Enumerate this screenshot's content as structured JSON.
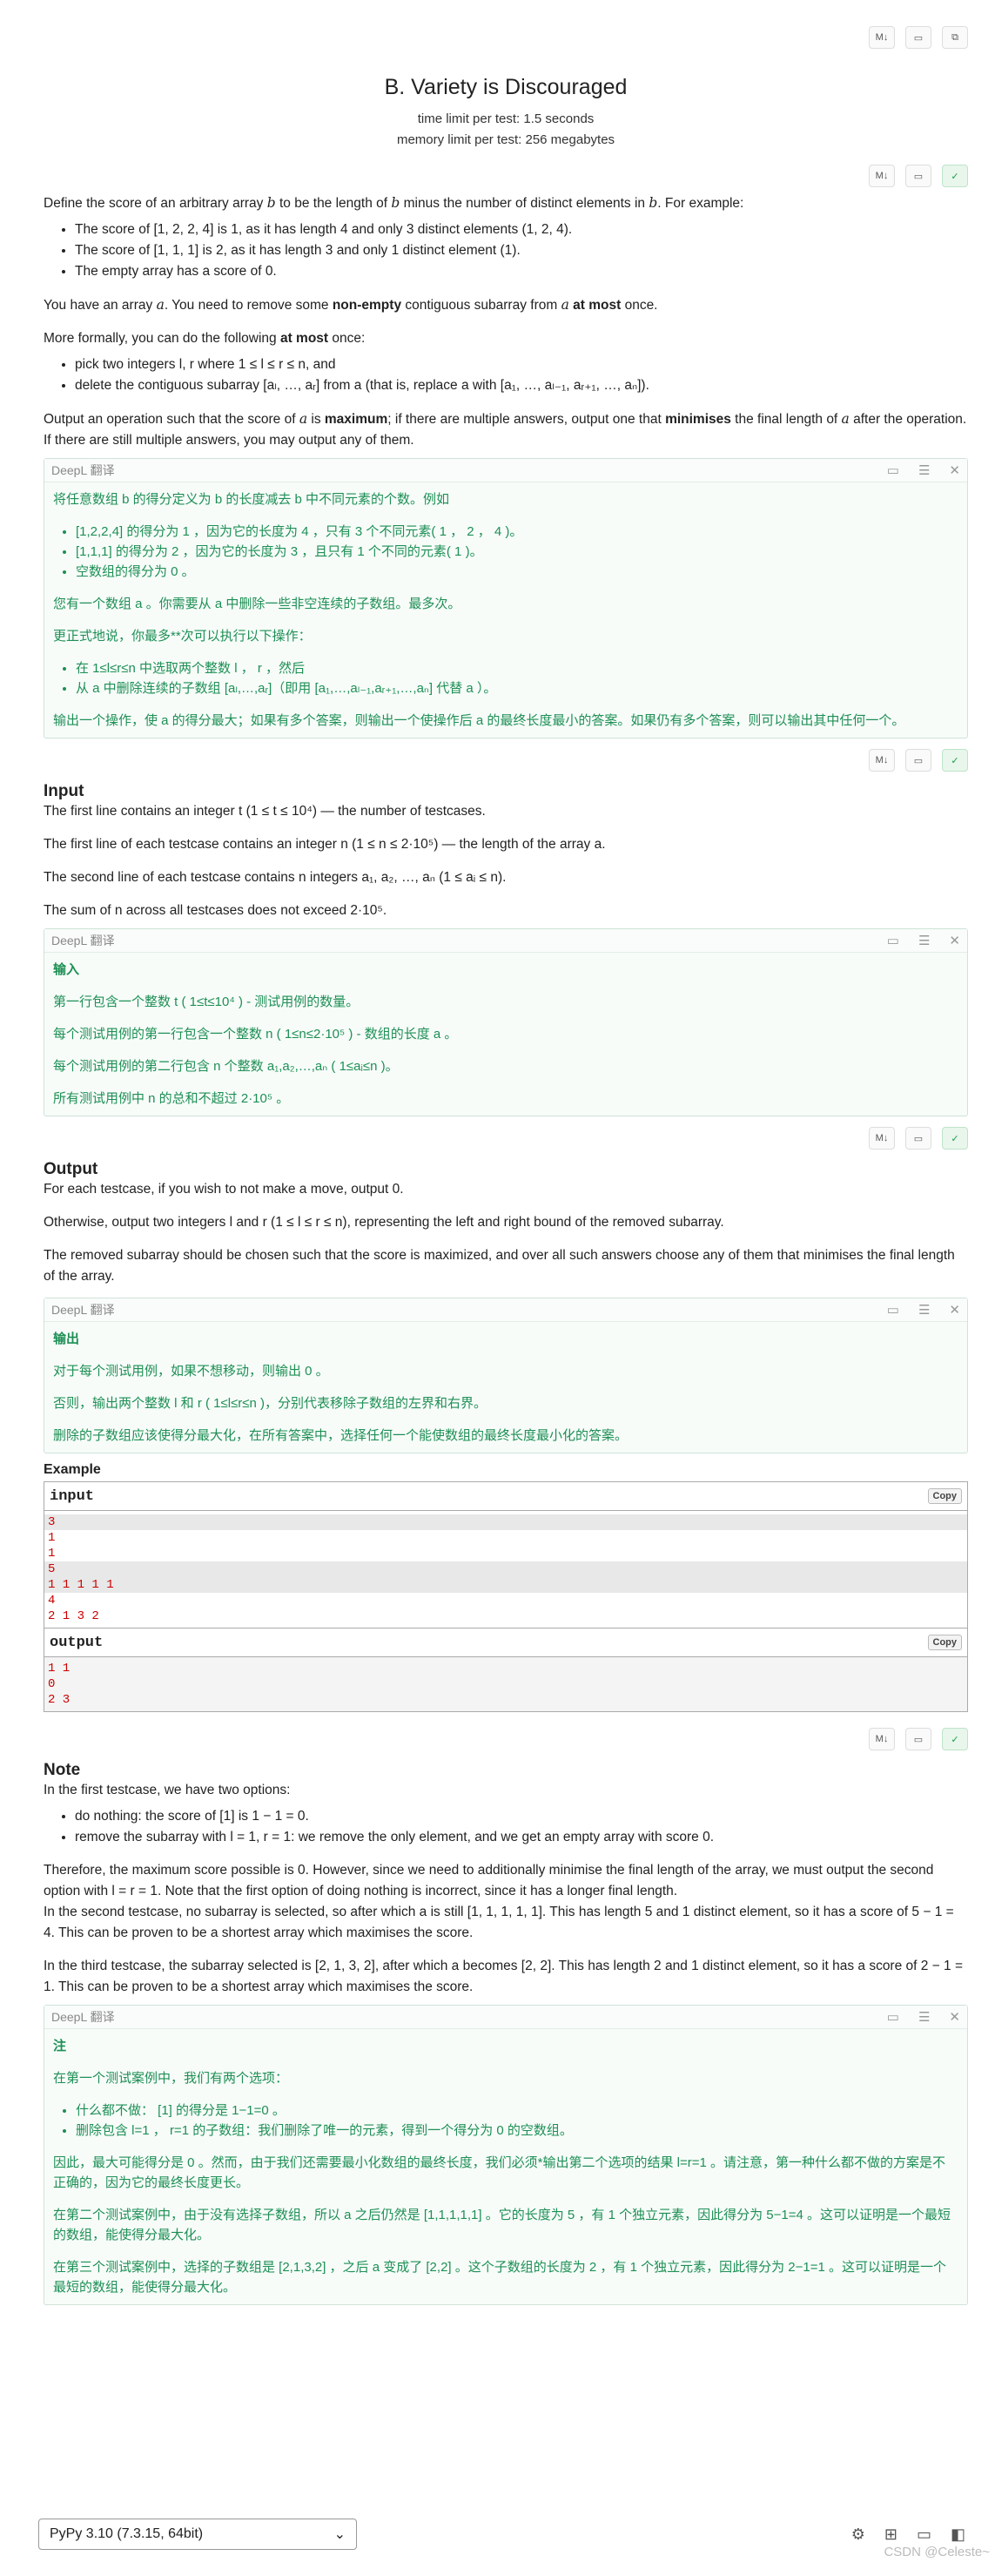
{
  "toolbar": {
    "md_label": "M↓",
    "copy_icon": "clipboard-icon",
    "done_icon": "check-icon"
  },
  "problem": {
    "title": "B. Variety is Discouraged",
    "time_limit": "time limit per test: 1.5 seconds",
    "memory_limit": "memory limit per test: 256 megabytes"
  },
  "statement": {
    "p1a": "Define the score of an arbitrary array ",
    "p1b": " to be the length of ",
    "p1c": " minus the number of distinct elements in ",
    "p1d": ". For example:",
    "li1": "The score of [1, 2, 2, 4] is 1, as it has length 4 and only 3 distinct elements (1, 2, 4).",
    "li2": "The score of [1, 1, 1] is 2, as it has length 3 and only 1 distinct element (1).",
    "li3": "The empty array has a score of 0.",
    "p2a": "You have an array ",
    "p2b": ". You need to remove some ",
    "p2c": "non-empty",
    "p2d": " contiguous subarray from ",
    "p2e": " at most",
    "p2f": " once.",
    "p3a": "More formally, you can do the following ",
    "p3b": "at most",
    "p3c": " once:",
    "li4": "pick two integers l, r where 1 ≤ l ≤ r ≤ n, and",
    "li5": "delete the contiguous subarray [aₗ, …, aᵣ] from a (that is, replace a with [a₁, …, aₗ₋₁, aᵣ₊₁, …, aₙ]).",
    "p4a": "Output an operation such that the score of ",
    "p4b": " is ",
    "p4c": "maximum",
    "p4d": "; if there are multiple answers, output one that ",
    "p4e": "minimises",
    "p4f": " the final length of ",
    "p4g": " after the operation. If there are still multiple answers, you may output any of them."
  },
  "deepl": {
    "label": "DeepL 翻译",
    "s1_p1": "将任意数组 b 的得分定义为 b 的长度减去 b 中不同元素的个数。例如",
    "s1_li1": "[1,2,2,4] 的得分为 1 ，因为它的长度为 4 ，只有 3 个不同元素( 1 ， 2 ， 4 )。",
    "s1_li2": "[1,1,1] 的得分为 2 ，因为它的长度为 3 ，且只有 1 个不同的元素( 1 )。",
    "s1_li3": "空数组的得分为 0 。",
    "s1_p2": "您有一个数组 a 。你需要从 a 中删除一些非空连续的子数组。最多次。",
    "s1_p3": "更正式地说，你最多**次可以执行以下操作：",
    "s1_li4": "在 1≤l≤r≤n 中选取两个整数 l ， r ，然后",
    "s1_li5": "从 a 中删除连续的子数组 [aₗ,…,aᵣ]（即用 [a₁,…,aₗ₋₁,aᵣ₊₁,…,aₙ] 代替 a ）。",
    "s1_p4": "输出一个操作，使 a 的得分最大；如果有多个答案，则输出一个使操作后 a 的最终长度最小的答案。如果仍有多个答案，则可以输出其中任何一个。",
    "s2_title": "输入",
    "s2_p1": "第一行包含一个整数 t ( 1≤t≤10⁴ ) - 测试用例的数量。",
    "s2_p2": "每个测试用例的第一行包含一个整数 n ( 1≤n≤2·10⁵ ) - 数组的长度 a 。",
    "s2_p3": "每个测试用例的第二行包含 n 个整数 a₁,a₂,…,aₙ ( 1≤aᵢ≤n )。",
    "s2_p4": "所有测试用例中 n 的总和不超过 2·10⁵ 。",
    "s3_title": "输出",
    "s3_p1": "对于每个测试用例，如果不想移动，则输出 0 。",
    "s3_p2": "否则，输出两个整数 l 和 r ( 1≤l≤r≤n )，分别代表移除子数组的左界和右界。",
    "s3_p3": "删除的子数组应该使得分最大化，在所有答案中，选择任何一个能使数组的最终长度最小化的答案。",
    "s4_title": "注",
    "s4_p1": "在第一个测试案例中，我们有两个选项：",
    "s4_li1": "什么都不做： [1] 的得分是 1−1=0 。",
    "s4_li2": "删除包含 l=1 ， r=1 的子数组：我们删除了唯一的元素，得到一个得分为 0 的空数组。",
    "s4_p2": "因此，最大可能得分是 0 。然而，由于我们还需要最小化数组的最终长度，我们必须*输出第二个选项的结果 l=r=1 。请注意，第一种什么都不做的方案是不正确的，因为它的最终长度更长。",
    "s4_p3": "在第二个测试案例中，由于没有选择子数组，所以 a 之后仍然是 [1,1,1,1,1] 。它的长度为 5 ，有 1 个独立元素，因此得分为 5−1=4 。这可以证明是一个最短的数组，能使得分最大化。",
    "s4_p4": "在第三个测试案例中，选择的子数组是 [2,1,3,2] ，之后 a 变成了 [2,2] 。这个子数组的长度为 2 ，有 1 个独立元素，因此得分为 2−1=1 。这可以证明是一个最短的数组，能使得分最大化。"
  },
  "input_section": {
    "title": "Input",
    "p1": "The first line contains an integer t (1 ≤ t ≤ 10⁴) — the number of testcases.",
    "p2": "The first line of each testcase contains an integer n (1 ≤ n ≤ 2·10⁵) — the length of the array a.",
    "p3": "The second line of each testcase contains n integers a₁, a₂, …, aₙ (1 ≤ aᵢ ≤ n).",
    "p4": "The sum of n across all testcases does not exceed 2·10⁵."
  },
  "output_section": {
    "title": "Output",
    "p1": "For each testcase, if you wish to not make a move, output 0.",
    "p2": "Otherwise, output two integers l and r (1 ≤ l ≤ r ≤ n), representing the left and right bound of the removed subarray.",
    "p3": "The removed subarray should be chosen such that the score is maximized, and over all such answers choose any of them that minimises the final length of the array."
  },
  "example": {
    "title": "Example",
    "input_label": "input",
    "output_label": "output",
    "copy": "Copy",
    "input_lines": [
      "3",
      "1",
      "1",
      "5",
      "1 1 1 1 1",
      "4",
      "2 1 3 2"
    ],
    "output_lines": [
      "1 1",
      "0",
      "2 3"
    ]
  },
  "note": {
    "title": "Note",
    "p1": "In the first testcase, we have two options:",
    "li1": "do nothing: the score of [1] is 1 − 1 = 0.",
    "li2": "remove the subarray with l = 1, r = 1: we remove the only element, and we get an empty array with score 0.",
    "p2": "Therefore, the maximum score possible is 0. However, since we need to additionally minimise the final length of the array, we must output the second option with l = r = 1. Note that the first option of doing nothing is incorrect, since it has a longer final length.",
    "p3": "In the second testcase, no subarray is selected, so after which a is still [1, 1, 1, 1, 1]. This has length 5 and 1 distinct element, so it has a score of 5 − 1 = 4. This can be proven to be a shortest array which maximises the score.",
    "p4": "In the third testcase, the subarray selected is [2, 1, 3, 2], after which a becomes [2, 2]. This has length 2 and 1 distinct element, so it has a score of 2 − 1 = 1. This can be proven to be a shortest array which maximises the score."
  },
  "bottom": {
    "language": "PyPy 3.10 (7.3.15, 64bit)",
    "watermark": "CSDN @Celeste~"
  }
}
